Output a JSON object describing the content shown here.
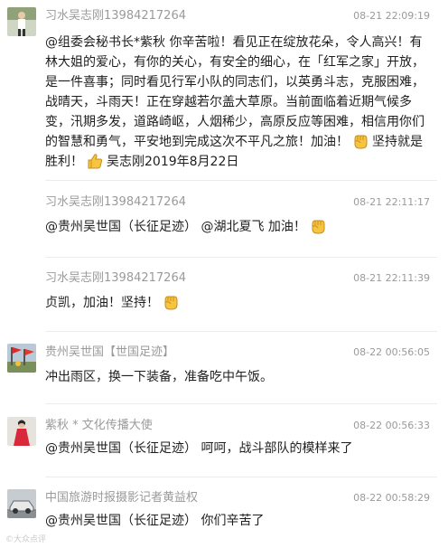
{
  "comments": [
    {
      "author": "习水吴志刚13984217264",
      "time": "08-21 22:09:19",
      "text_before": "@组委会秘书长*紫秋 你辛苦啦！看见正在绽放花朵，令人高兴！有林大姐的爱心，有你的关心，有安全的细心，在「红军之家」开放，是一件喜事；同时看见行军小队的同志们，以英勇斗志，克服困难，战晴天，斗雨天！正在穿越若尔盖大草原。当前面临着近期气候多变，汛期多发，道路崎岖，人烟稀少，高原反应等困难，相信用你们的智慧和勇气，平安地到完成这次不平凡之旅！加油！",
      "text_mid": "坚持就是胜利！",
      "text_after": "吴志刚2019年8月22日",
      "emoji1": "fist-emoji",
      "emoji2": "thumbs-up-emoji",
      "avatar": "avatar-man-standing"
    },
    {
      "author": "习水吴志刚13984217264",
      "time": "08-21 22:11:17",
      "text_before": "@贵州吴世国（长征足迹） @湖北夏飞 加油！",
      "emoji1": "fist-emoji"
    },
    {
      "author": "习水吴志刚13984217264",
      "time": "08-21 22:11:39",
      "text_before": "贞凯，加油！坚持！",
      "emoji1": "fist-emoji"
    },
    {
      "author": "贵州吴世国【世国足迹】",
      "time": "08-22 00:56:05",
      "text_before": "冲出雨区，换一下装备，准备吃中午饭。",
      "avatar": "avatar-red-flags"
    },
    {
      "author": "紫秋 * 文化传播大使",
      "time": "08-22 00:56:33",
      "text_before": "@贵州吴世国（长征足迹） 呵呵，战斗部队的模样来了",
      "avatar": "avatar-woman-red-dress"
    },
    {
      "author": "中国旅游时报摄影记者黄益权",
      "time": "08-22 00:58:29",
      "text_before": "@贵州吴世国（长征足迹） 你们辛苦了",
      "avatar": "avatar-car"
    }
  ],
  "watermark": "©大众点评",
  "colors": {
    "meta": "#9a9a9a",
    "text": "#1e1e1e",
    "divider": "#ececec",
    "emoji_yellow": "#f5c542"
  }
}
